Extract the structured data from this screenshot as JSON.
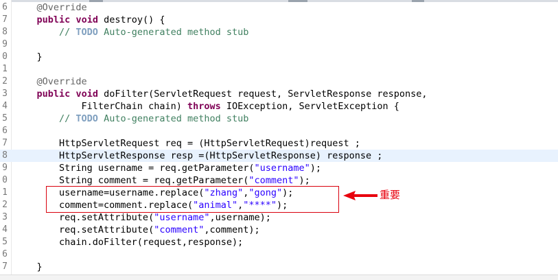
{
  "editor": {
    "lines": [
      {
        "n": "6",
        "hl": false,
        "tokens": [
          {
            "t": "    "
          },
          {
            "t": "@Override",
            "c": "ann"
          }
        ]
      },
      {
        "n": "7",
        "hl": false,
        "tokens": [
          {
            "t": "    "
          },
          {
            "t": "public",
            "c": "kw"
          },
          {
            "t": " "
          },
          {
            "t": "void",
            "c": "kw"
          },
          {
            "t": " destroy() {"
          }
        ]
      },
      {
        "n": "8",
        "hl": false,
        "tokens": [
          {
            "t": "        "
          },
          {
            "t": "// ",
            "c": "cm"
          },
          {
            "t": "TODO",
            "c": "todo"
          },
          {
            "t": " Auto-generated method stub",
            "c": "cm"
          }
        ]
      },
      {
        "n": "9",
        "hl": false,
        "tokens": []
      },
      {
        "n": "0",
        "hl": false,
        "tokens": [
          {
            "t": "    }"
          }
        ]
      },
      {
        "n": "1",
        "hl": false,
        "tokens": []
      },
      {
        "n": "2",
        "hl": false,
        "tokens": [
          {
            "t": "    "
          },
          {
            "t": "@Override",
            "c": "ann"
          }
        ]
      },
      {
        "n": "3",
        "hl": false,
        "tokens": [
          {
            "t": "    "
          },
          {
            "t": "public",
            "c": "kw"
          },
          {
            "t": " "
          },
          {
            "t": "void",
            "c": "kw"
          },
          {
            "t": " doFilter(ServletRequest request, ServletResponse response,"
          }
        ]
      },
      {
        "n": "4",
        "hl": false,
        "tokens": [
          {
            "t": "            FilterChain chain) "
          },
          {
            "t": "throws",
            "c": "kw"
          },
          {
            "t": " IOException, ServletException {"
          }
        ]
      },
      {
        "n": "5",
        "hl": false,
        "tokens": [
          {
            "t": "        "
          },
          {
            "t": "// ",
            "c": "cm"
          },
          {
            "t": "TODO",
            "c": "todo"
          },
          {
            "t": " Auto-generated method stub",
            "c": "cm"
          }
        ]
      },
      {
        "n": "6",
        "hl": false,
        "tokens": []
      },
      {
        "n": "7",
        "hl": false,
        "tokens": [
          {
            "t": "        HttpServletRequest req = (HttpServletRequest)request ;"
          }
        ]
      },
      {
        "n": "8",
        "hl": true,
        "tokens": [
          {
            "t": "        HttpServletResponse resp =(HttpServletResponse) response ;"
          }
        ]
      },
      {
        "n": "9",
        "hl": false,
        "tokens": [
          {
            "t": "        String username = req.getParameter("
          },
          {
            "t": "\"username\"",
            "c": "str"
          },
          {
            "t": ");"
          }
        ]
      },
      {
        "n": "0",
        "hl": false,
        "tokens": [
          {
            "t": "        String comment = req.getParameter("
          },
          {
            "t": "\"comment\"",
            "c": "str"
          },
          {
            "t": ");"
          }
        ]
      },
      {
        "n": "1",
        "hl": false,
        "tokens": [
          {
            "t": "        username=username.replace("
          },
          {
            "t": "\"zhang\"",
            "c": "str"
          },
          {
            "t": ","
          },
          {
            "t": "\"gong\"",
            "c": "str"
          },
          {
            "t": ");"
          }
        ]
      },
      {
        "n": "2",
        "hl": false,
        "tokens": [
          {
            "t": "        comment=comment.replace("
          },
          {
            "t": "\"animal\"",
            "c": "str"
          },
          {
            "t": ","
          },
          {
            "t": "\"****\"",
            "c": "str"
          },
          {
            "t": ");"
          }
        ]
      },
      {
        "n": "3",
        "hl": false,
        "tokens": [
          {
            "t": "        req.setAttribute("
          },
          {
            "t": "\"username\"",
            "c": "str"
          },
          {
            "t": ",username);"
          }
        ]
      },
      {
        "n": "4",
        "hl": false,
        "tokens": [
          {
            "t": "        req.setAttribute("
          },
          {
            "t": "\"comment\"",
            "c": "str"
          },
          {
            "t": ",comment);"
          }
        ]
      },
      {
        "n": "5",
        "hl": false,
        "tokens": [
          {
            "t": "        chain.doFilter(request,response);"
          }
        ]
      },
      {
        "n": "6",
        "hl": false,
        "tokens": []
      },
      {
        "n": "7",
        "hl": false,
        "tokens": [
          {
            "t": "    }"
          }
        ]
      }
    ]
  },
  "annotation": {
    "label": "重要",
    "color": "#e8000d"
  },
  "colors": {
    "keyword": "#7f0055",
    "annotation": "#646464",
    "comment": "#3f7f5f",
    "todo": "#7f9fbf",
    "string": "#2a00ff",
    "current_line": "#e8f2fe"
  }
}
